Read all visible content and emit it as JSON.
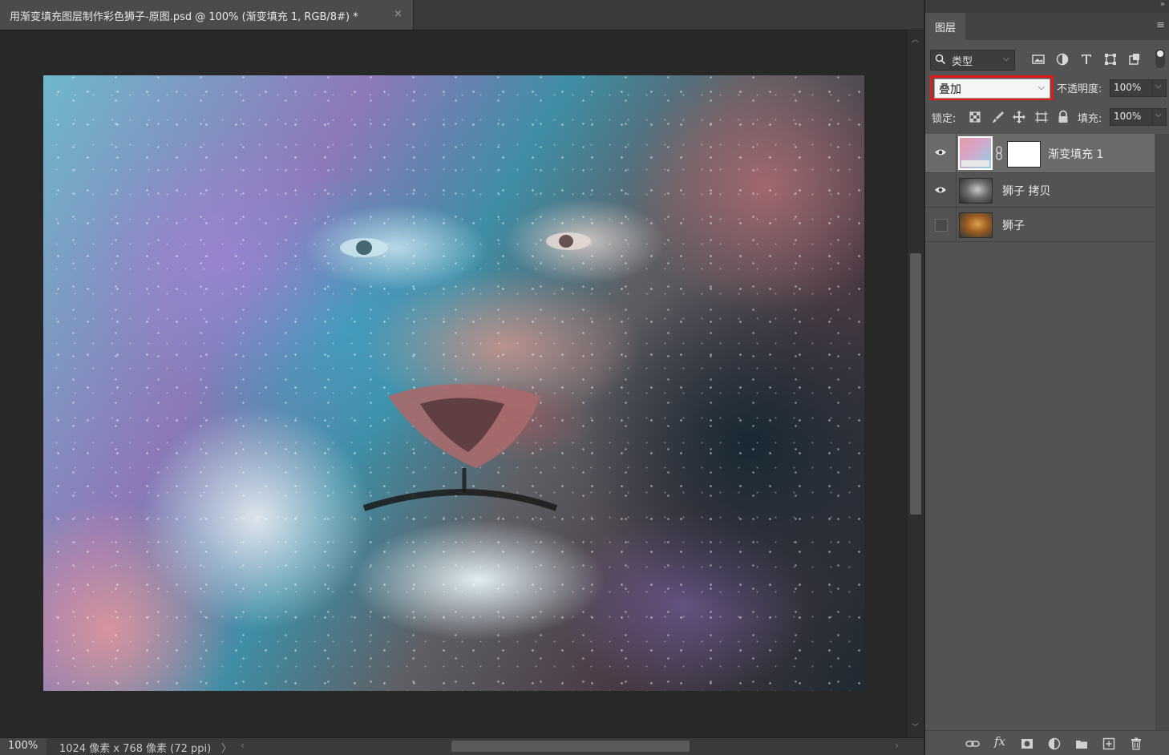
{
  "document": {
    "tab_title": "用渐变填充图层制作彩色狮子-原图.psd @ 100% (渐变填充 1, RGB/8#) *",
    "close_glyph": "×"
  },
  "status_bar": {
    "zoom": "100%",
    "doc_info": "1024 像素 x 768 像素 (72 ppi)",
    "info_arrow": "〉",
    "hscroll_left": "‹",
    "hscroll_right": "›"
  },
  "scrollbar": {
    "up": "︿",
    "down": "﹀"
  },
  "layers_panel": {
    "collapse_glyph": "»",
    "menu_glyph": "≡",
    "tab_label": "图层",
    "filter": {
      "label": "类型",
      "chevron": "⌵",
      "icons": [
        "image-filter-icon",
        "adjustment-filter-icon",
        "type-filter-icon",
        "shape-filter-icon",
        "smart-object-filter-icon"
      ]
    },
    "blend_mode": "叠加",
    "blend_chevron": "⌵",
    "opacity_label": "不透明度:",
    "opacity_value": "100%",
    "lock_label": "锁定:",
    "lock_icons": [
      "lock-transparent-icon",
      "lock-image-icon",
      "lock-position-icon",
      "lock-artboard-icon",
      "lock-all-icon"
    ],
    "fill_label": "填充:",
    "fill_value": "100%",
    "drop_chevron": "⌵",
    "layers": [
      {
        "name": "渐变填充 1",
        "visible": true,
        "selected": true,
        "thumbnail": "gradient-fill-thumbnail"
      },
      {
        "name": "狮子 拷贝",
        "visible": true,
        "selected": false,
        "thumbnail": "lion-copy-thumbnail"
      },
      {
        "name": "狮子",
        "visible": false,
        "selected": false,
        "thumbnail": "lion-thumbnail"
      }
    ],
    "bottom_tools": {
      "fx": "fx",
      "icons": [
        "link-layers-icon",
        "add-style-icon",
        "add-mask-icon",
        "new-adjustment-icon",
        "new-group-icon",
        "new-layer-icon",
        "delete-layer-icon"
      ]
    }
  },
  "colors": {
    "highlight_border": "#e21a1a",
    "panel_bg": "#535353",
    "selected_row": "#6b6b6b",
    "canvas_bg": "#282828"
  }
}
